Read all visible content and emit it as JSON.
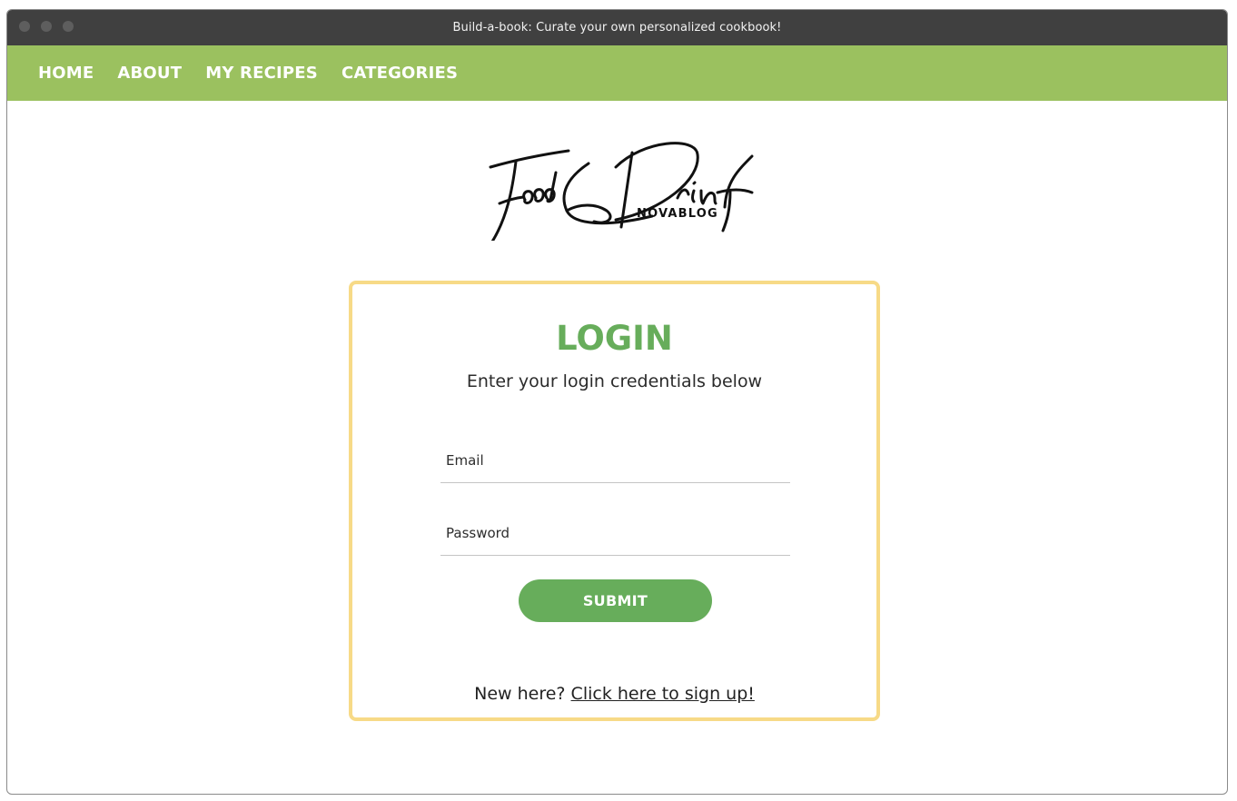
{
  "window": {
    "title": "Build-a-book: Curate your own personalized cookbook!"
  },
  "nav": {
    "items": [
      {
        "label": "HOME"
      },
      {
        "label": "ABOUT"
      },
      {
        "label": "MY RECIPES"
      },
      {
        "label": "CATEGORIES"
      }
    ]
  },
  "logo": {
    "script_text": "Food & Drink",
    "caption": "NOVABLOG"
  },
  "login": {
    "title": "LOGIN",
    "subtitle": "Enter your login credentials below",
    "email_placeholder": "Email",
    "email_value": "",
    "password_placeholder": "Password",
    "password_value": "",
    "submit_label": "SUBMIT",
    "signup_prompt": "New here?",
    "signup_link": "Click here to sign up!"
  },
  "colors": {
    "nav_bg": "#9bc15f",
    "accent_green": "#67ad5b",
    "card_border": "#f7da87",
    "titlebar_bg": "#404040"
  }
}
